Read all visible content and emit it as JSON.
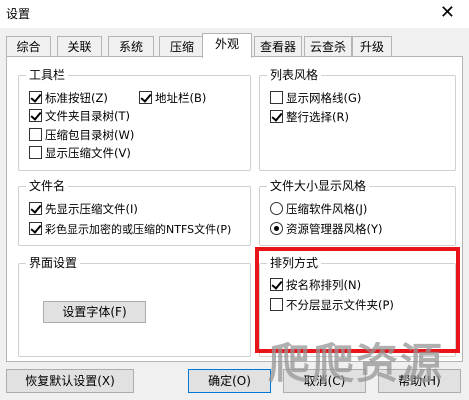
{
  "window": {
    "title": "设置",
    "close_icon": "close-icon"
  },
  "tabs": [
    {
      "label": "综合"
    },
    {
      "label": "关联"
    },
    {
      "label": "系统"
    },
    {
      "label": "压缩"
    },
    {
      "label": "外观",
      "active": true
    },
    {
      "label": "查看器"
    },
    {
      "label": "云查杀"
    },
    {
      "label": "升级"
    }
  ],
  "toolbar_group": {
    "title": "工具栏",
    "items": [
      {
        "label": "标准按钮(Z)",
        "checked": true
      },
      {
        "label": "地址栏(B)",
        "checked": true
      },
      {
        "label": "文件夹目录树(T)",
        "checked": true
      },
      {
        "label": "压缩包目录树(W)",
        "checked": false
      },
      {
        "label": "显示压缩文件(V)",
        "checked": false
      }
    ]
  },
  "list_style_group": {
    "title": "列表风格",
    "items": [
      {
        "label": "显示网格线(G)",
        "checked": false
      },
      {
        "label": "整行选择(R)",
        "checked": true
      }
    ]
  },
  "filename_group": {
    "title": "文件名",
    "items": [
      {
        "label": "先显示压缩文件(I)",
        "checked": true
      },
      {
        "label": "彩色显示加密的或压缩的NTFS文件(P)",
        "checked": true
      }
    ]
  },
  "filesize_group": {
    "title": "文件大小显示风格",
    "options": [
      {
        "label": "压缩软件风格(J)",
        "selected": false
      },
      {
        "label": "资源管理器风格(Y)",
        "selected": true
      }
    ]
  },
  "ui_group": {
    "title": "界面设置",
    "font_button": "设置字体(F)"
  },
  "sort_group": {
    "title": "排列方式",
    "items": [
      {
        "label": "按名称排列(N)",
        "checked": true
      },
      {
        "label": "不分层显示文件夹(P)",
        "checked": false
      }
    ]
  },
  "buttons": {
    "restore": "恢复默认设置(X)",
    "ok": "确定(O)",
    "cancel": "取消(C)",
    "help": "帮助(H)"
  },
  "watermark": "爬爬资源",
  "colors": {
    "highlight_frame": "#e8141a",
    "default_button_border": "#0078d7"
  }
}
